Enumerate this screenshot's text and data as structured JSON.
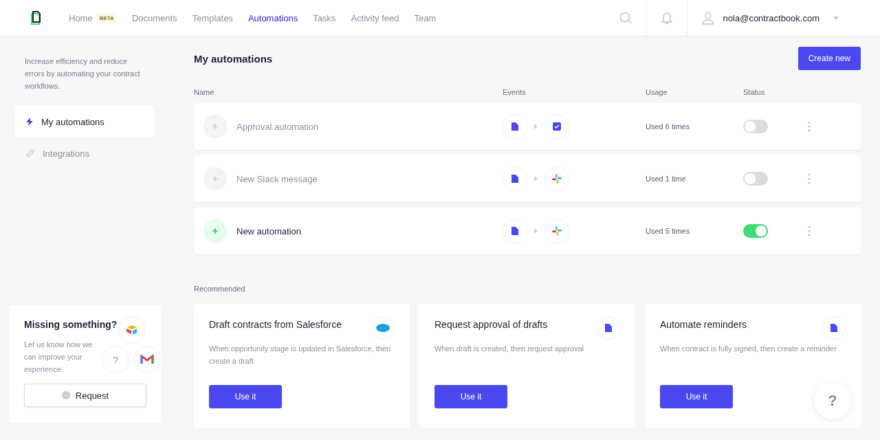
{
  "nav": {
    "items": [
      {
        "label": "Home",
        "badge": "BETA",
        "selected": false
      },
      {
        "label": "Documents",
        "selected": false
      },
      {
        "label": "Templates",
        "selected": false
      },
      {
        "label": "Automations",
        "selected": true
      },
      {
        "label": "Tasks",
        "selected": false
      },
      {
        "label": "Activity feed",
        "selected": false
      },
      {
        "label": "Team",
        "selected": false
      }
    ],
    "user": "nola@contractbook.com"
  },
  "sidebar": {
    "intro": "Increase efficiency and reduce errors by automating your contract workflows.",
    "items": [
      {
        "label": "My automations",
        "kind": "bolt",
        "selected": true
      },
      {
        "label": "Integrations",
        "kind": "link",
        "selected": false
      }
    ],
    "missing": {
      "title": "Missing something?",
      "text": "Let us know how we can improve your experience.",
      "help_glyph": "?",
      "button": "Request"
    }
  },
  "main": {
    "title": "My automations",
    "create_button": "Create new",
    "columns": [
      "Name",
      "Events",
      "Usage",
      "Status"
    ],
    "rows": [
      {
        "name": "Approval automation",
        "events": [
          {
            "kind": "document"
          },
          {
            "kind": "checkbox"
          }
        ],
        "usage": "Used 6 times",
        "on": false
      },
      {
        "name": "New Slack message",
        "events": [
          {
            "kind": "document"
          },
          {
            "kind": "slack"
          }
        ],
        "usage": "Used 1 time",
        "on": false
      },
      {
        "name": "New automation",
        "events": [
          {
            "kind": "document"
          },
          {
            "kind": "slack"
          }
        ],
        "usage": "Used 5 times",
        "on": true
      }
    ],
    "recommended_title": "Recommended",
    "recommended": [
      {
        "title": "Draft contracts from Salesforce",
        "text": "When opportunity stage is updated in Salesforce, then create a draft",
        "kind": "salesforce",
        "button": "Use it"
      },
      {
        "title": "Request approval of drafts",
        "text": "When draft is created, then request approval",
        "kind": "document",
        "button": "Use it"
      },
      {
        "title": "Automate reminders",
        "text": "When contract is fully signed, then create a reminder",
        "kind": "document",
        "button": "Use it"
      }
    ]
  },
  "help_button": "?"
}
